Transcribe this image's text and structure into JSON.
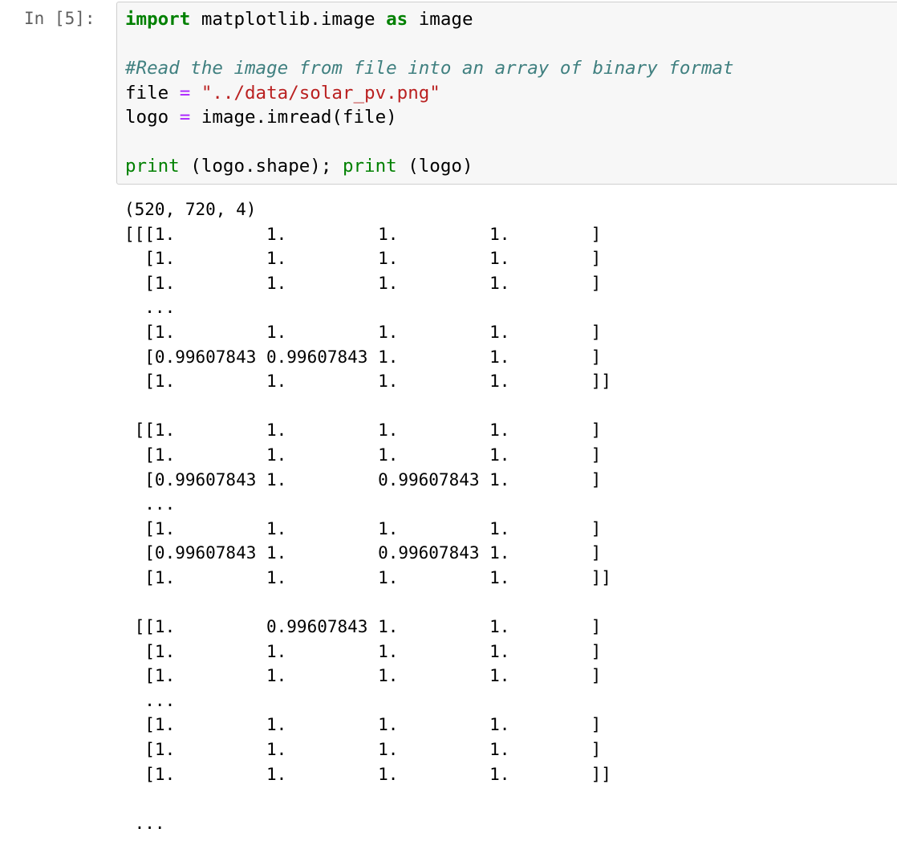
{
  "cell": {
    "prompt": "In [5]:",
    "code_lines": [
      [
        {
          "t": "import",
          "c": "kw"
        },
        {
          "t": " matplotlib.image ",
          "c": "nm"
        },
        {
          "t": "as",
          "c": "kw"
        },
        {
          "t": " image",
          "c": "nm"
        }
      ],
      [],
      [
        {
          "t": "#Read the image from file into an array of binary format",
          "c": "cm"
        }
      ],
      [
        {
          "t": "file ",
          "c": "nm"
        },
        {
          "t": "=",
          "c": "op"
        },
        {
          "t": " ",
          "c": "nm"
        },
        {
          "t": "\"../data/solar_pv.png\"",
          "c": "st"
        }
      ],
      [
        {
          "t": "logo ",
          "c": "nm"
        },
        {
          "t": "=",
          "c": "op"
        },
        {
          "t": " image.imread(file)",
          "c": "nm"
        }
      ],
      [],
      [
        {
          "t": "print",
          "c": "bi"
        },
        {
          "t": " (logo.shape); ",
          "c": "nm"
        },
        {
          "t": "print",
          "c": "bi"
        },
        {
          "t": " (logo)",
          "c": "nm"
        }
      ]
    ],
    "output_lines": [
      "(520, 720, 4)",
      "[[[1.         1.         1.         1.        ]",
      "  [1.         1.         1.         1.        ]",
      "  [1.         1.         1.         1.        ]",
      "  ...",
      "  [1.         1.         1.         1.        ]",
      "  [0.99607843 0.99607843 1.         1.        ]",
      "  [1.         1.         1.         1.        ]]",
      "",
      " [[1.         1.         1.         1.        ]",
      "  [1.         1.         1.         1.        ]",
      "  [0.99607843 1.         0.99607843 1.        ]",
      "  ...",
      "  [1.         1.         1.         1.        ]",
      "  [0.99607843 1.         0.99607843 1.        ]",
      "  [1.         1.         1.         1.        ]]",
      "",
      " [[1.         0.99607843 1.         1.        ]",
      "  [1.         1.         1.         1.        ]",
      "  [1.         1.         1.         1.        ]",
      "  ...",
      "  [1.         1.         1.         1.        ]",
      "  [1.         1.         1.         1.        ]",
      "  [1.         1.         1.         1.        ]]",
      "",
      " ..."
    ]
  },
  "colors": {
    "keyword": "#008000",
    "comment": "#408080",
    "string": "#ba2121",
    "operator": "#aa22ff",
    "prompt": "#5f5f5f",
    "input_background": "#f7f7f7",
    "input_border": "#cfcfcf"
  }
}
